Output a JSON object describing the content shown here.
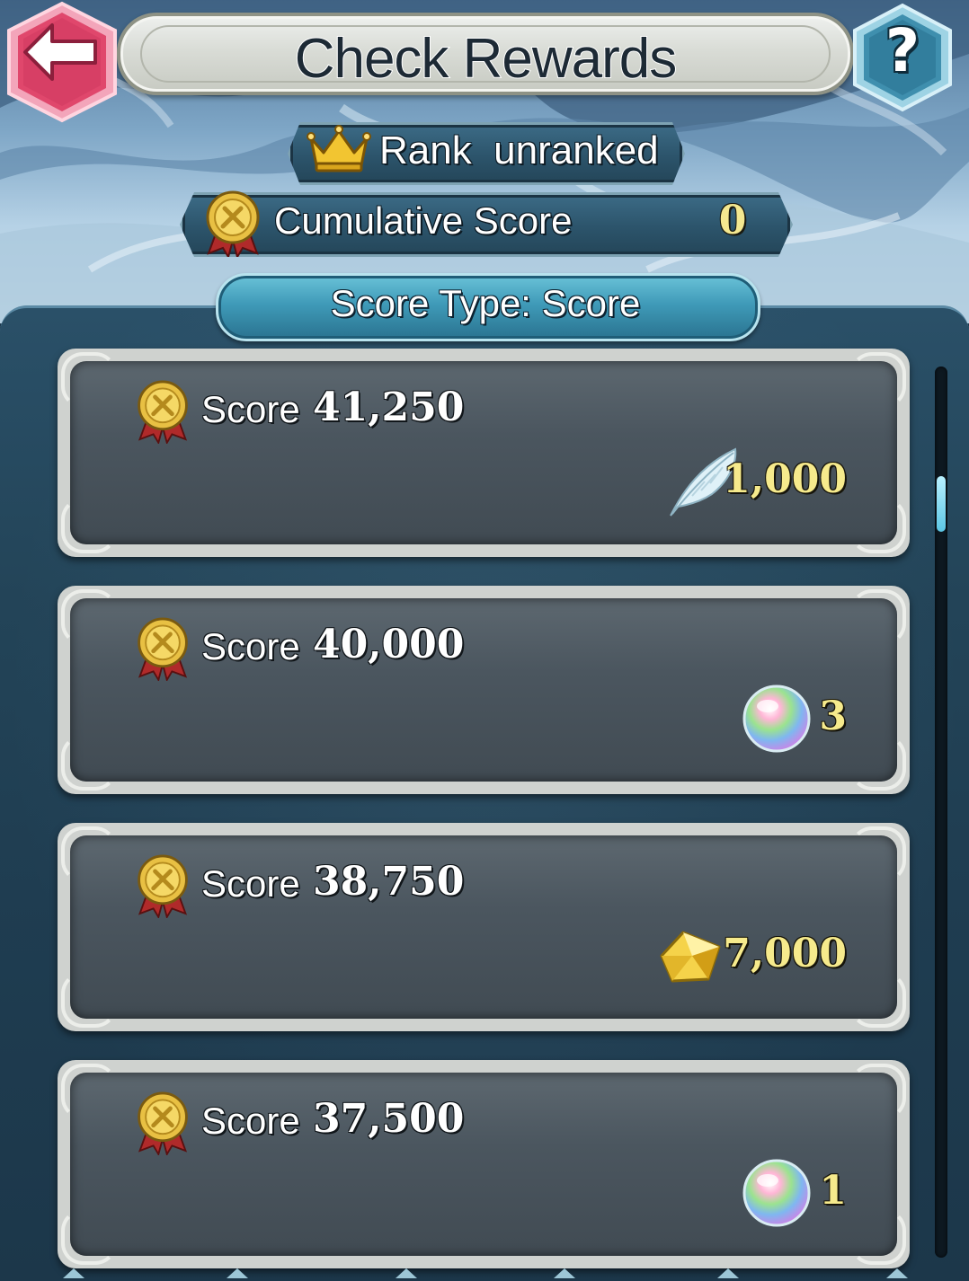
{
  "header": {
    "title": "Check Rewards",
    "back_icon": "back-arrow-icon",
    "help_icon": "help-question-icon",
    "help_label": "?"
  },
  "rank": {
    "label": "Rank  unranked",
    "icon": "crown-icon"
  },
  "cumulative": {
    "label": "Cumulative Score",
    "value": "0",
    "icon": "score-medal-icon"
  },
  "score_type": {
    "label": "Score Type: Score"
  },
  "rewards": [
    {
      "score_label": "Score",
      "score": "41,250",
      "reward_icon": "feather-icon",
      "quantity": "1,000"
    },
    {
      "score_label": "Score",
      "score": "40,000",
      "reward_icon": "orb-icon",
      "quantity": "3"
    },
    {
      "score_label": "Score",
      "score": "38,750",
      "reward_icon": "crystal-icon",
      "quantity": "7,000"
    },
    {
      "score_label": "Score",
      "score": "37,500",
      "reward_icon": "orb-icon",
      "quantity": "1"
    }
  ],
  "colors": {
    "accent_gold": "#f6ea8c",
    "back_button": "#e0476c",
    "help_button": "#3f8fae",
    "tab_active": "#3f9ab8"
  }
}
